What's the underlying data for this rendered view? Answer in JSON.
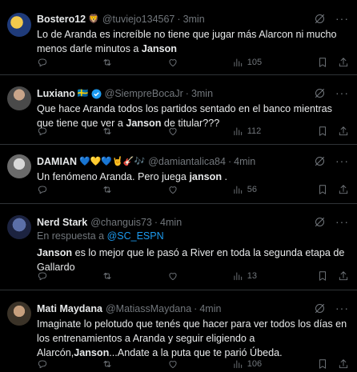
{
  "tweets": [
    {
      "name": "Bostero12",
      "emoji": "🦁",
      "handle": "@tuviejo134567",
      "time": "3min",
      "text_before": "Lo de Aranda es increíble no tiene que jugar más Alarcon ni mucho menos darle minutos a ",
      "bold": "Janson",
      "text_after": "",
      "views": "105"
    },
    {
      "name": "Luxiano",
      "emoji": "🇸🇪",
      "handle": "@SiempreBocaJr",
      "time": "3min",
      "text_before": "Que hace Aranda todos los partidos sentado en el banco mientras que tiene que ver a ",
      "bold": "Janson",
      "text_after": " de titular???",
      "views": "112"
    },
    {
      "name": "DAMIAN",
      "emoji": "💙💛💙🤘🎸🎶",
      "handle": "@damiantalica84",
      "time": "4min",
      "text_before": "Un fenómeno Aranda. Pero juega ",
      "bold": "janson",
      "text_after": " .",
      "views": "56"
    },
    {
      "name": "Nerd Stark",
      "emoji": "",
      "handle": "@changuis73",
      "time": "4min",
      "reply_prefix": "En respuesta a ",
      "reply_handle": "@SC_ESPN",
      "text_before": "",
      "bold": "Janson",
      "text_after": " es lo mejor que le pasó a River en toda la segunda etapa de Gallardo",
      "views": "13"
    },
    {
      "name": "Mati Maydana",
      "emoji": "",
      "handle": "@MatiassMaydana",
      "time": "4min",
      "text_before": "Imaginate lo pelotudo que tenés que hacer para ver todos los días en los entrenamientos a Aranda y seguir eligiendo a Alarcón,",
      "bold": "Janson",
      "text_after": "...Andate a la puta que te parió Úbeda.",
      "views": "106"
    }
  ],
  "colors": {
    "background": "#000000",
    "text": "#e7e9ea",
    "muted": "#71767b",
    "link": "#1d9bf0"
  }
}
